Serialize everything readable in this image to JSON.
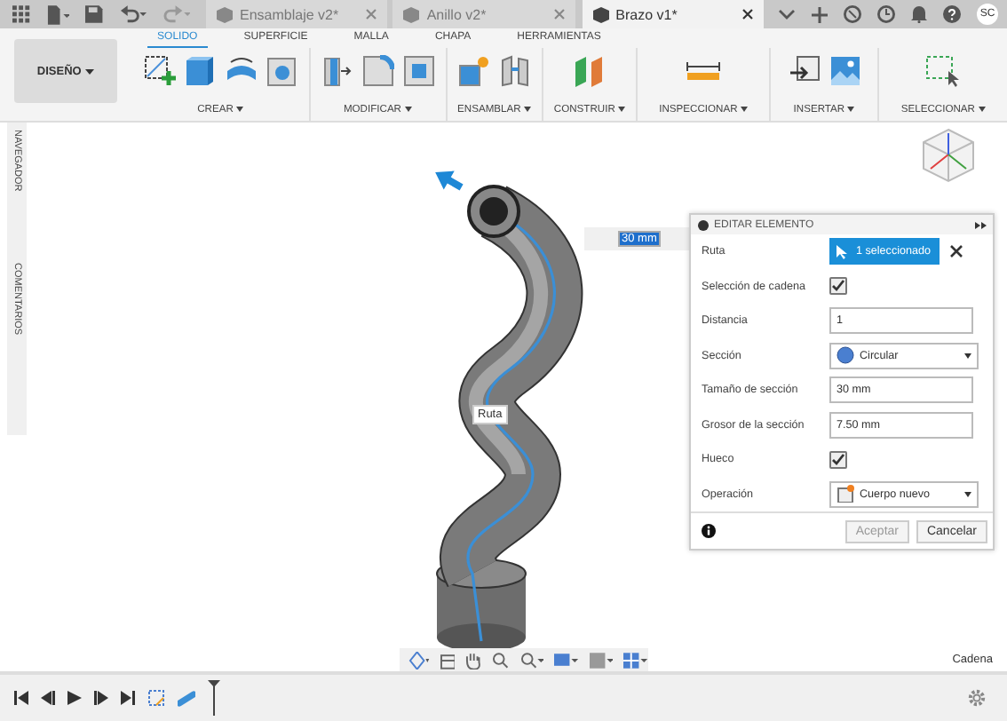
{
  "doc_tabs": [
    {
      "label": "Ensamblaje v2*",
      "selected": false
    },
    {
      "label": "Anillo v2*",
      "selected": false
    },
    {
      "label": "Brazo v1*",
      "selected": true
    }
  ],
  "user_initials": "SC",
  "workspace": "DISEÑO",
  "ribbon_tabs": [
    {
      "label": "SOLIDO",
      "selected": true
    },
    {
      "label": "SUPERFICIE",
      "selected": false
    },
    {
      "label": "MALLA",
      "selected": false
    },
    {
      "label": "CHAPA",
      "selected": false
    },
    {
      "label": "HERRAMIENTAS",
      "selected": false
    }
  ],
  "ribbon_groups": [
    "CREAR",
    "MODIFICAR",
    "ENSAMBLAR",
    "CONSTRUIR",
    "INSPECCIONAR",
    "INSERTAR",
    "SELECCIONAR"
  ],
  "side_tabs": [
    "NAVEGADOR",
    "COMENTARIOS"
  ],
  "viewport": {
    "path_label": "Ruta",
    "dimension_value": "30 mm"
  },
  "dialog": {
    "title": "EDITAR ELEMENTO",
    "rows": [
      {
        "kind": "selection",
        "label": "Ruta",
        "value": "1 seleccionado"
      },
      {
        "kind": "checkbox",
        "label": "Selección de cadena",
        "checked": true
      },
      {
        "kind": "text",
        "label": "Distancia",
        "value": "1"
      },
      {
        "kind": "dropdown",
        "label": "Sección",
        "value": "Circular"
      },
      {
        "kind": "text",
        "label": "Tamaño de sección",
        "value": "30 mm"
      },
      {
        "kind": "text",
        "label": "Grosor de la sección",
        "value": "7.50 mm"
      },
      {
        "kind": "checkbox",
        "label": "Hueco",
        "checked": true
      },
      {
        "kind": "dropdown",
        "label": "Operación",
        "value": "Cuerpo nuevo"
      }
    ],
    "ok": {
      "label": "Aceptar",
      "disabled": true
    },
    "cancel": "Cancelar"
  },
  "status": "Cadena"
}
